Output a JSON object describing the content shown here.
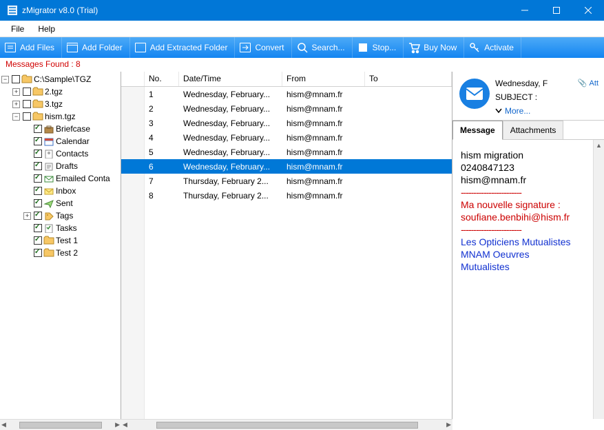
{
  "window": {
    "title": "zMigrator v8.0 (Trial)"
  },
  "menu": {
    "file": "File",
    "help": "Help"
  },
  "toolbar": {
    "add_files": "Add Files",
    "add_folder": "Add Folder",
    "add_extracted": "Add Extracted Folder",
    "convert": "Convert",
    "search": "Search...",
    "stop": "Stop...",
    "buy": "Buy Now",
    "activate": "Activate"
  },
  "status": {
    "messages_found": "Messages Found : 8"
  },
  "tree": {
    "root": "C:\\Sample\\TGZ",
    "nodes": [
      {
        "label": "2.tgz"
      },
      {
        "label": "3.tgz"
      },
      {
        "label": "hism.tgz",
        "children": [
          {
            "label": "Briefcase"
          },
          {
            "label": "Calendar"
          },
          {
            "label": "Contacts"
          },
          {
            "label": "Drafts"
          },
          {
            "label": "Emailed Conta"
          },
          {
            "label": "Inbox"
          },
          {
            "label": "Sent"
          },
          {
            "label": "Tags"
          },
          {
            "label": "Tasks"
          },
          {
            "label": "Test 1"
          },
          {
            "label": "Test 2"
          }
        ]
      }
    ]
  },
  "list": {
    "columns": {
      "no": "No.",
      "date": "Date/Time",
      "from": "From",
      "to": "To"
    },
    "rows": [
      {
        "no": "1",
        "date": "Wednesday, February...",
        "from": "hism@mnam.fr",
        "to": ""
      },
      {
        "no": "2",
        "date": "Wednesday, February...",
        "from": "hism@mnam.fr",
        "to": ""
      },
      {
        "no": "3",
        "date": "Wednesday, February...",
        "from": "hism@mnam.fr",
        "to": ""
      },
      {
        "no": "4",
        "date": "Wednesday, February...",
        "from": "hism@mnam.fr",
        "to": ""
      },
      {
        "no": "5",
        "date": "Wednesday, February...",
        "from": "hism@mnam.fr",
        "to": ""
      },
      {
        "no": "6",
        "date": "Wednesday, February...",
        "from": "hism@mnam.fr",
        "to": "",
        "selected": true
      },
      {
        "no": "7",
        "date": "Thursday, February 2...",
        "from": "hism@mnam.fr",
        "to": ""
      },
      {
        "no": "8",
        "date": "Thursday, February 2...",
        "from": "hism@mnam.fr",
        "to": ""
      }
    ]
  },
  "preview": {
    "date": "Wednesday, F",
    "attach": "Att",
    "subject_label": "SUBJECT :",
    "more": "More...",
    "tabs": {
      "message": "Message",
      "attachments": "Attachments"
    },
    "body": {
      "l1": "hism migration",
      "l2": "0240847123",
      "l3": "hism@mnam.fr",
      "sep": "------------------------",
      "sig1": "Ma nouvelle signature :",
      "sig2": "soufiane.benbihi@hism.fr",
      "org1": "Les Opticiens Mutualistes",
      "org2": "MNAM Oeuvres",
      "org3": "Mutualistes"
    }
  }
}
